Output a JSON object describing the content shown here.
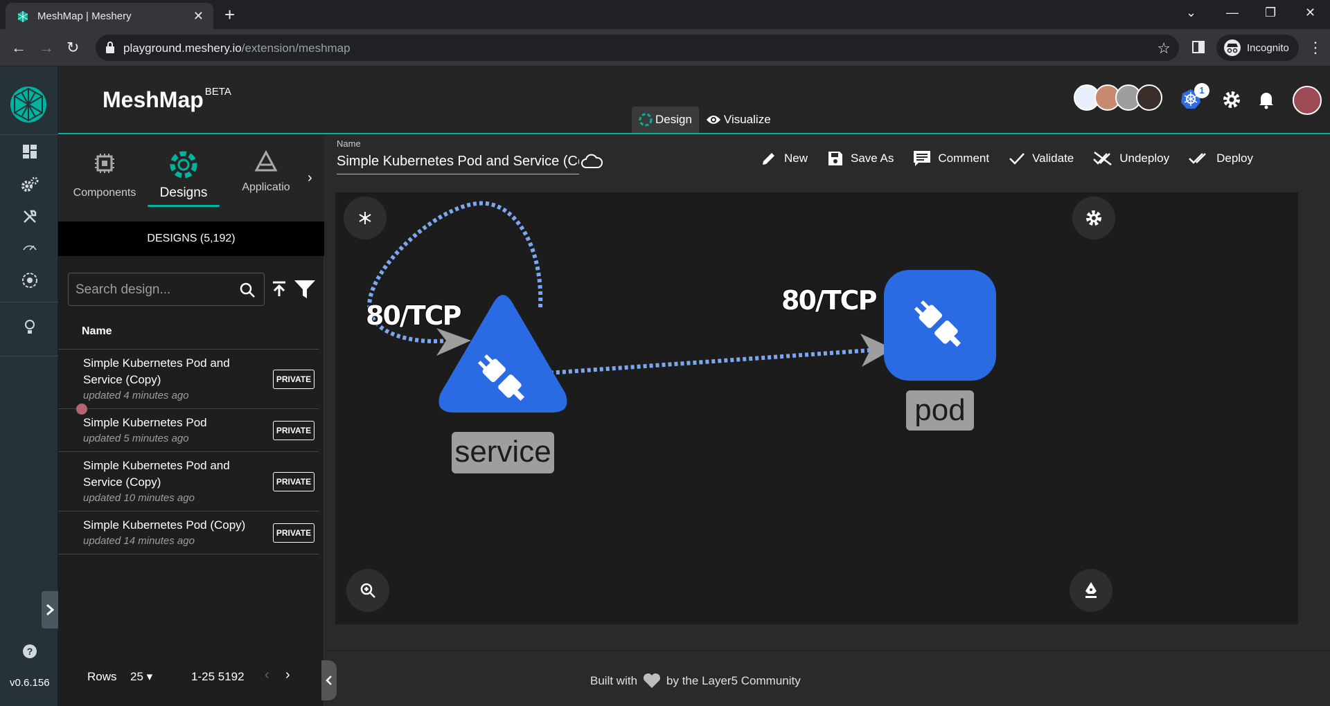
{
  "browser": {
    "tab_title": "MeshMap | Meshery",
    "url_host": "playground.meshery.io",
    "url_path": "/extension/meshmap",
    "profile_label": "Incognito"
  },
  "rail": {
    "version": "v0.6.156",
    "items": [
      "dashboard-icon",
      "lifecycle-icon",
      "configuration-icon",
      "performance-icon",
      "extensions-icon",
      "lightbulb-icon"
    ]
  },
  "header": {
    "brand": "MeshMap",
    "brand_sup": "BETA",
    "mode_design": "Design",
    "mode_visualize": "Visualize",
    "k8s_badge": "1"
  },
  "panel": {
    "tabs": [
      {
        "label": "Components",
        "icon": "components-icon"
      },
      {
        "label": "Designs",
        "icon": "designs-icon"
      },
      {
        "label": "Applicatio",
        "icon": "applications-icon"
      }
    ],
    "designs_count": "DESIGNS (5,192)",
    "search_placeholder": "Search design...",
    "column_name": "Name",
    "rows": [
      {
        "name": "Simple Kubernetes Pod and Service (Copy)",
        "updated": "updated 4 minutes ago",
        "visibility": "PRIVATE"
      },
      {
        "name": "Simple Kubernetes Pod",
        "updated": "updated 5 minutes ago",
        "visibility": "PRIVATE"
      },
      {
        "name": "Simple Kubernetes Pod and Service (Copy)",
        "updated": "updated 10 minutes ago",
        "visibility": "PRIVATE"
      },
      {
        "name": "Simple Kubernetes Pod (Copy)",
        "updated": "updated 14 minutes ago",
        "visibility": "PRIVATE"
      }
    ],
    "pager": {
      "rows_label": "Rows",
      "rows_value": "25",
      "range": "1-25 5192"
    }
  },
  "main": {
    "name_label": "Name",
    "name_value": "Simple Kubernetes Pod and Service (Copy)",
    "toolbar": {
      "new": "New",
      "save_as": "Save As",
      "comment": "Comment",
      "validate": "Validate",
      "undeploy": "Undeploy",
      "deploy": "Deploy"
    },
    "canvas": {
      "nodes": [
        {
          "label": "service",
          "shape": "triangle"
        },
        {
          "label": "pod",
          "shape": "rounded-square"
        }
      ],
      "edges": [
        {
          "label": "80/TCP"
        },
        {
          "label": "80/TCP"
        }
      ],
      "node_color": "#2a6ae2",
      "edge_color": "#7ba7f0"
    },
    "footer_left": "Built with",
    "footer_right": "by the Layer5 Community"
  },
  "colors": {
    "accent": "#00b39f",
    "node": "#2a6ae2"
  }
}
